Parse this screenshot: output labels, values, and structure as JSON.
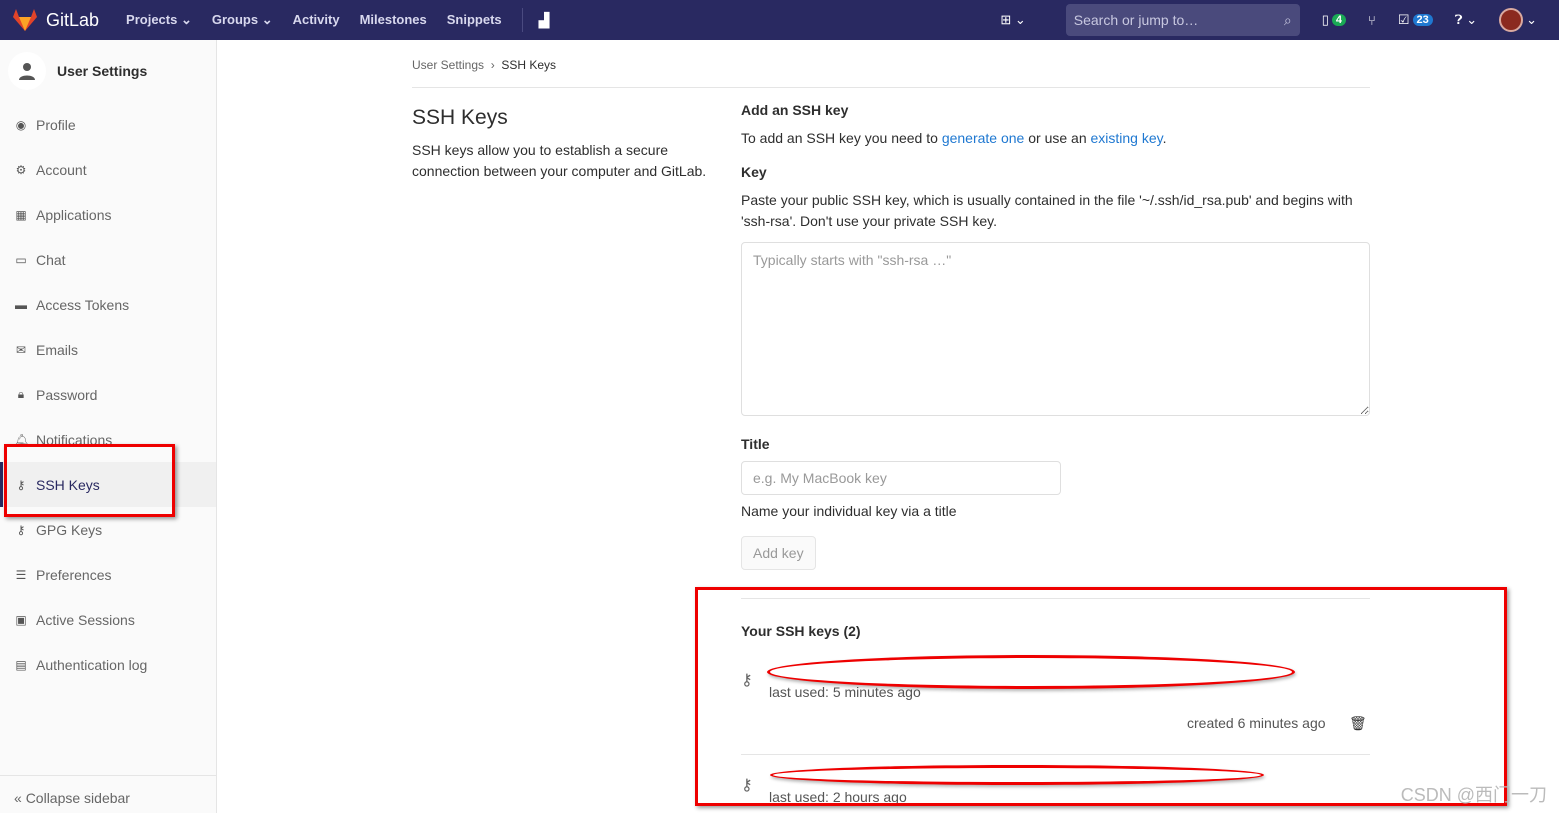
{
  "nav": {
    "brand": "GitLab",
    "links": [
      "Projects ⌄",
      "Groups ⌄",
      "Activity",
      "Milestones",
      "Snippets"
    ],
    "search_placeholder": "Search or jump to…",
    "issues_count": "4",
    "todos_count": "23"
  },
  "sidebar": {
    "title": "User Settings",
    "items": [
      {
        "label": "Profile",
        "icon": "◉"
      },
      {
        "label": "Account",
        "icon": "⚙"
      },
      {
        "label": "Applications",
        "icon": "▦"
      },
      {
        "label": "Chat",
        "icon": "▭"
      },
      {
        "label": "Access Tokens",
        "icon": "▬"
      },
      {
        "label": "Emails",
        "icon": "✉"
      },
      {
        "label": "Password",
        "icon": "🔒︎"
      },
      {
        "label": "Notifications",
        "icon": "🔔︎"
      },
      {
        "label": "SSH Keys",
        "icon": "⚷"
      },
      {
        "label": "GPG Keys",
        "icon": "⚷"
      },
      {
        "label": "Preferences",
        "icon": "☰"
      },
      {
        "label": "Active Sessions",
        "icon": "▣"
      },
      {
        "label": "Authentication log",
        "icon": "▤"
      }
    ],
    "active": "SSH Keys",
    "collapse": "Collapse sidebar"
  },
  "breadcrumb": {
    "parent": "User Settings",
    "current": "SSH Keys"
  },
  "page": {
    "title": "SSH Keys",
    "description": "SSH keys allow you to establish a secure connection between your computer and GitLab."
  },
  "form": {
    "add_heading": "Add an SSH key",
    "intro_pre": "To add an SSH key you need to ",
    "generate_link": "generate one",
    "intro_mid": " or use an ",
    "existing_link": "existing key",
    "intro_post": ".",
    "key_label": "Key",
    "key_help": "Paste your public SSH key, which is usually contained in the file '~/.ssh/id_rsa.pub' and begins with 'ssh-rsa'. Don't use your private SSH key.",
    "key_placeholder": "Typically starts with \"ssh-rsa …\"",
    "title_label": "Title",
    "title_placeholder": "e.g. My MacBook key",
    "title_help": "Name your individual key via a title",
    "add_button": "Add key"
  },
  "keys": {
    "heading": "Your SSH keys (2)",
    "items": [
      {
        "last_used": "last used: 5 minutes ago",
        "created": "created 6 minutes ago"
      },
      {
        "last_used": "last used: 2 hours ago"
      }
    ]
  },
  "watermark": "CSDN @西门一刀"
}
